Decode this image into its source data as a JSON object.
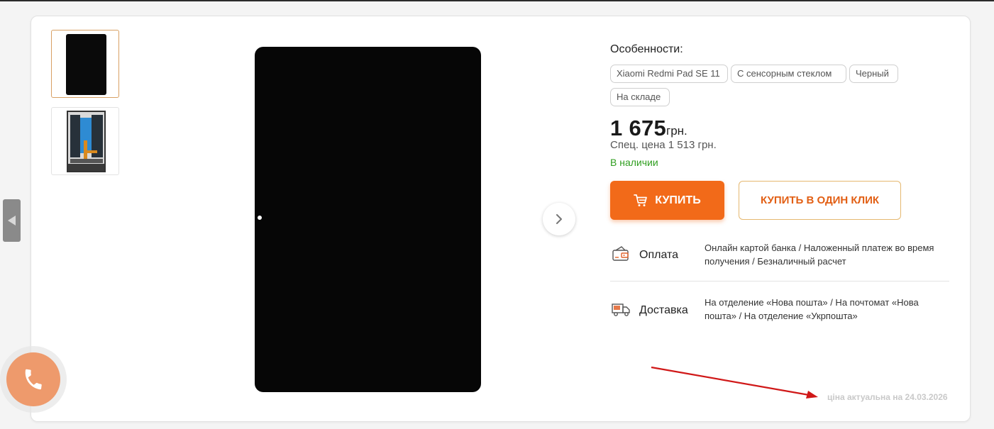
{
  "gallery": {
    "thumbnails": [
      {
        "icon": "tablet-display-front-thumbnail",
        "active": true
      },
      {
        "icon": "tablet-display-back-thumbnail",
        "active": false
      }
    ],
    "main_image_icon": "tablet-display-image",
    "next_icon": "chevron-right-icon",
    "side_tab_icon": "triangle-left-icon"
  },
  "product": {
    "features_title": "Особенности:",
    "tags": [
      "Xiaomi Redmi Pad SE 11",
      "С сенсорным стеклом",
      "Черный",
      "На складе"
    ],
    "price": "1 675",
    "currency": "грн.",
    "special_price": "Спец. цена 1 513 грн.",
    "stock_status": "В наличии",
    "buy_label": "КУПИТЬ",
    "one_click_label": "КУПИТЬ В ОДИН КЛИК"
  },
  "info": {
    "payment": {
      "label": "Оплата",
      "text": "Онлайн картой банка / Наложенный платеж во время получения / Безналичный расчет",
      "icon": "wallet-card-icon"
    },
    "delivery": {
      "label": "Доставка",
      "text": "На отделение «Нова пошта» / На почтомат «Нова пошта» / На отделение «Укрпошта»",
      "icon": "delivery-truck-icon"
    }
  },
  "actual_note": "ціна актуальна на 24.03.2026",
  "colors": {
    "accent": "#f26a19",
    "in_stock": "#2f9e1f",
    "annotation_arrow": "#d01818",
    "call_button": "#ee9a6c"
  },
  "call_widget_icon": "phone-icon"
}
